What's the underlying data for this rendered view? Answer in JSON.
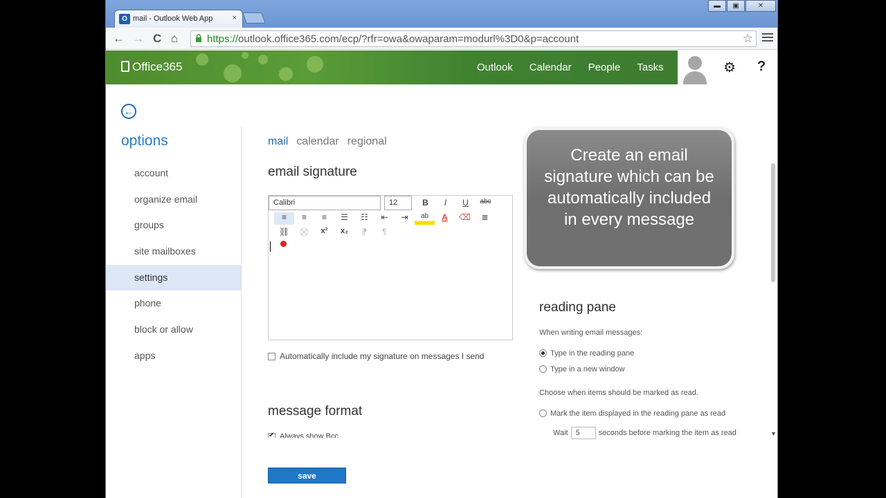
{
  "browser": {
    "tab_title": "mail - Outlook Web App",
    "tab_icon": "O",
    "tab_close": "×",
    "url_scheme": "https://",
    "url_rest": "outlook.office365.com/ecp/?rfr=owa&owaparam=modurl%3D0&p=account",
    "back_glyph": "←",
    "forward_glyph": "→",
    "reload_glyph": "C",
    "home_glyph": "⌂",
    "star_glyph": "☆",
    "min_glyph": "▬",
    "max_glyph": "▣",
    "close_glyph": "✕"
  },
  "header": {
    "logo": "Office365",
    "nav": [
      "Outlook",
      "Calendar",
      "People",
      "Tasks"
    ],
    "gear_glyph": "⚙",
    "help_glyph": "?"
  },
  "sidebar": {
    "back_glyph": "←",
    "title": "options",
    "items": [
      {
        "label": "account"
      },
      {
        "label": "organize email"
      },
      {
        "label": "groups"
      },
      {
        "label": "site mailboxes"
      },
      {
        "label": "settings"
      },
      {
        "label": "phone"
      },
      {
        "label": "block or allow"
      },
      {
        "label": "apps"
      }
    ]
  },
  "main": {
    "subtabs": [
      "mail",
      "calendar",
      "regional"
    ],
    "signature_title": "email signature",
    "font": "Calibri",
    "size": "12",
    "toolbar_row1": [
      "B",
      "I",
      "U",
      "abc"
    ],
    "toolbar_row2": [
      "≡",
      "≡",
      "≡",
      "☰",
      "☷",
      "⇤",
      "⇥",
      "ab",
      "A",
      "⌫",
      "≣"
    ],
    "toolbar_row3": [
      "⛓",
      "⛒",
      "x²",
      "x₂",
      "⁋",
      "¶"
    ],
    "auto_include": "Automatically include my signature on messages I send",
    "message_format_title": "message format",
    "always_show_bcc": "Always show Bcc",
    "save": "save"
  },
  "callout": {
    "text": "Create an email signature which can be automatically included in every message"
  },
  "reading_pane": {
    "title": "reading pane",
    "writing_label": "When writing email messages:",
    "option1": "Type in the reading pane",
    "option2": "Type in a new window",
    "mark_label": "Choose when items should be marked as read.",
    "mark_option": "Mark the item displayed in the reading pane as read",
    "wait_prefix": "Wait",
    "wait_value": "5",
    "wait_suffix": "seconds before marking the item as read",
    "scroll_down_glyph": "▼"
  }
}
